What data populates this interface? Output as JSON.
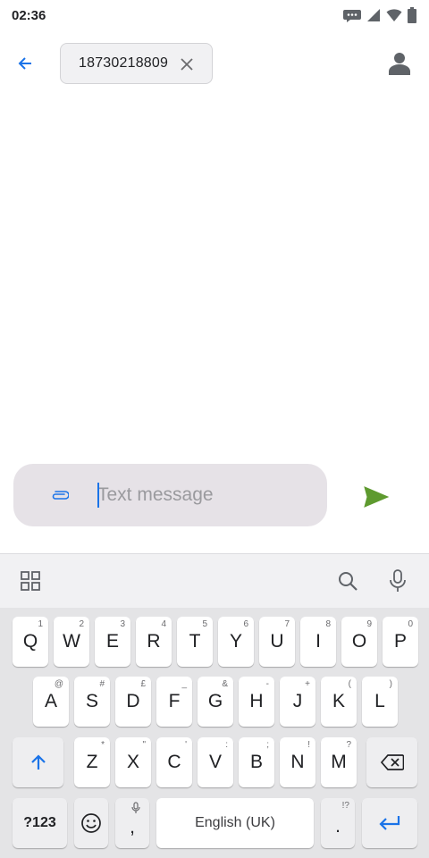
{
  "status_bar": {
    "time": "02:36",
    "icons": [
      "message-notification-icon",
      "signal-icon",
      "wifi-icon",
      "battery-icon"
    ]
  },
  "app_bar": {
    "back_icon": "arrow-left-icon",
    "recipient_chip": {
      "label": "18730218809",
      "close_icon": "close-icon"
    },
    "contact_icon": "person-icon"
  },
  "compose": {
    "attach_icon": "paperclip-icon",
    "placeholder": "Text message",
    "value": "",
    "send_icon": "send-icon"
  },
  "keyboard_toolbar": {
    "icons": [
      "apps-grid-icon",
      "search-icon",
      "microphone-icon"
    ]
  },
  "keyboard": {
    "row1": [
      {
        "label": "Q",
        "hint": "1"
      },
      {
        "label": "W",
        "hint": "2"
      },
      {
        "label": "E",
        "hint": "3"
      },
      {
        "label": "R",
        "hint": "4"
      },
      {
        "label": "T",
        "hint": "5"
      },
      {
        "label": "Y",
        "hint": "6"
      },
      {
        "label": "U",
        "hint": "7"
      },
      {
        "label": "I",
        "hint": "8"
      },
      {
        "label": "O",
        "hint": "9"
      },
      {
        "label": "P",
        "hint": "0"
      }
    ],
    "row2": [
      {
        "label": "A",
        "hint": "@"
      },
      {
        "label": "S",
        "hint": "#"
      },
      {
        "label": "D",
        "hint": "£"
      },
      {
        "label": "F",
        "hint": "_"
      },
      {
        "label": "G",
        "hint": "&"
      },
      {
        "label": "H",
        "hint": "-"
      },
      {
        "label": "J",
        "hint": "+"
      },
      {
        "label": "K",
        "hint": "("
      },
      {
        "label": "L",
        "hint": ")"
      }
    ],
    "row3": [
      {
        "label": "Z",
        "hint": "*"
      },
      {
        "label": "X",
        "hint": "\""
      },
      {
        "label": "C",
        "hint": "'"
      },
      {
        "label": "V",
        "hint": ":"
      },
      {
        "label": "B",
        "hint": ";"
      },
      {
        "label": "N",
        "hint": "!"
      },
      {
        "label": "M",
        "hint": "?"
      }
    ],
    "shift_icon": "shift-arrow-icon",
    "backspace_icon": "backspace-icon",
    "symbols_label": "?123",
    "emoji_icon": "emoji-icon",
    "comma": {
      "label": ",",
      "hint_icon": "microphone-icon"
    },
    "space_label": "English (UK)",
    "period": {
      "label": ".",
      "hint": "!?"
    },
    "enter_icon": "enter-icon"
  },
  "colors": {
    "accent_blue": "#1a73e8",
    "send_green": "#5e9a2f",
    "compose_bg": "#e6e2e7",
    "keyboard_bg": "#e4e4e6"
  }
}
